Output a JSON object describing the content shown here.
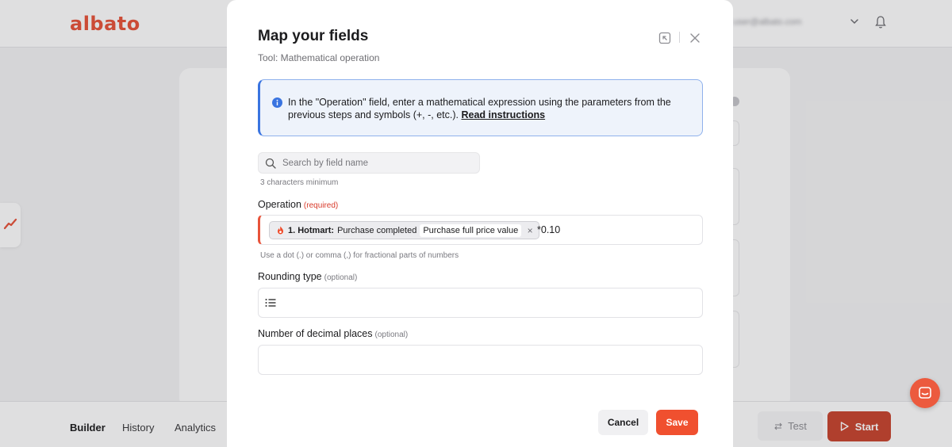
{
  "app": {
    "logo_text": "albato",
    "user_email": "user@albato.com"
  },
  "bottom_nav": {
    "items": [
      {
        "label": "Builder"
      },
      {
        "label": "History"
      },
      {
        "label": "Analytics"
      }
    ],
    "test_label": "Test",
    "start_label": "Start"
  },
  "modal": {
    "title": "Map your fields",
    "subtitle": "Tool: Mathematical operation",
    "info_text": "In the \"Operation\" field, enter a mathematical expression using the parameters from the previous steps and symbols (+, -, etc.).",
    "info_link": "Read instructions",
    "search": {
      "placeholder": "Search by field name",
      "value": "",
      "hint": "3 characters minimum"
    },
    "operation": {
      "label": "Operation",
      "required_tag": "(required)",
      "chip_app": "1. Hotmart:",
      "chip_event": "Purchase completed",
      "chip_param": "Purchase full price value",
      "chip_remove": "×",
      "suffix": "*0.10",
      "hint": "Use a dot (.) or comma (,) for fractional parts of numbers"
    },
    "rounding": {
      "label": "Rounding type",
      "optional_tag": "(optional)",
      "value": ""
    },
    "decimals": {
      "label": "Number of decimal places",
      "optional_tag": "(optional)",
      "value": ""
    },
    "cancel_label": "Cancel",
    "save_label": "Save"
  },
  "colors": {
    "brand": "#e8533a",
    "save": "#f0502f",
    "start": "#c9452f",
    "info_border": "#3a74e0",
    "required": "#d83a2a"
  }
}
